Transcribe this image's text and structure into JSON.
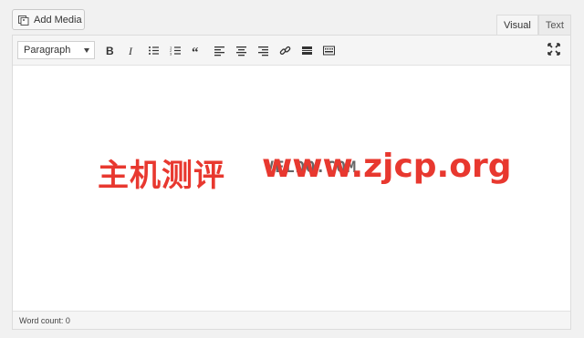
{
  "add_media": {
    "label": "Add Media",
    "icon": "media-icon"
  },
  "tabs": [
    {
      "label": "Visual",
      "active": true
    },
    {
      "label": "Text",
      "active": false
    }
  ],
  "toolbar": {
    "format_value": "Paragraph",
    "buttons": [
      "bold-icon",
      "italic-icon",
      "bullet-list-icon",
      "numbered-list-icon",
      "blockquote-icon",
      "align-left-icon",
      "align-center-icon",
      "align-right-icon",
      "link-icon",
      "read-more-icon",
      "toolbar-toggle-icon"
    ],
    "fullscreen_icon": "fullscreen-icon"
  },
  "watermark": {
    "chinese": "主机测评",
    "url": "www.zjcp.org",
    "grey_text": "VELDO.COM"
  },
  "footer": {
    "word_count": "Word count: 0"
  },
  "colors": {
    "watermark_red": "#e8382f"
  }
}
